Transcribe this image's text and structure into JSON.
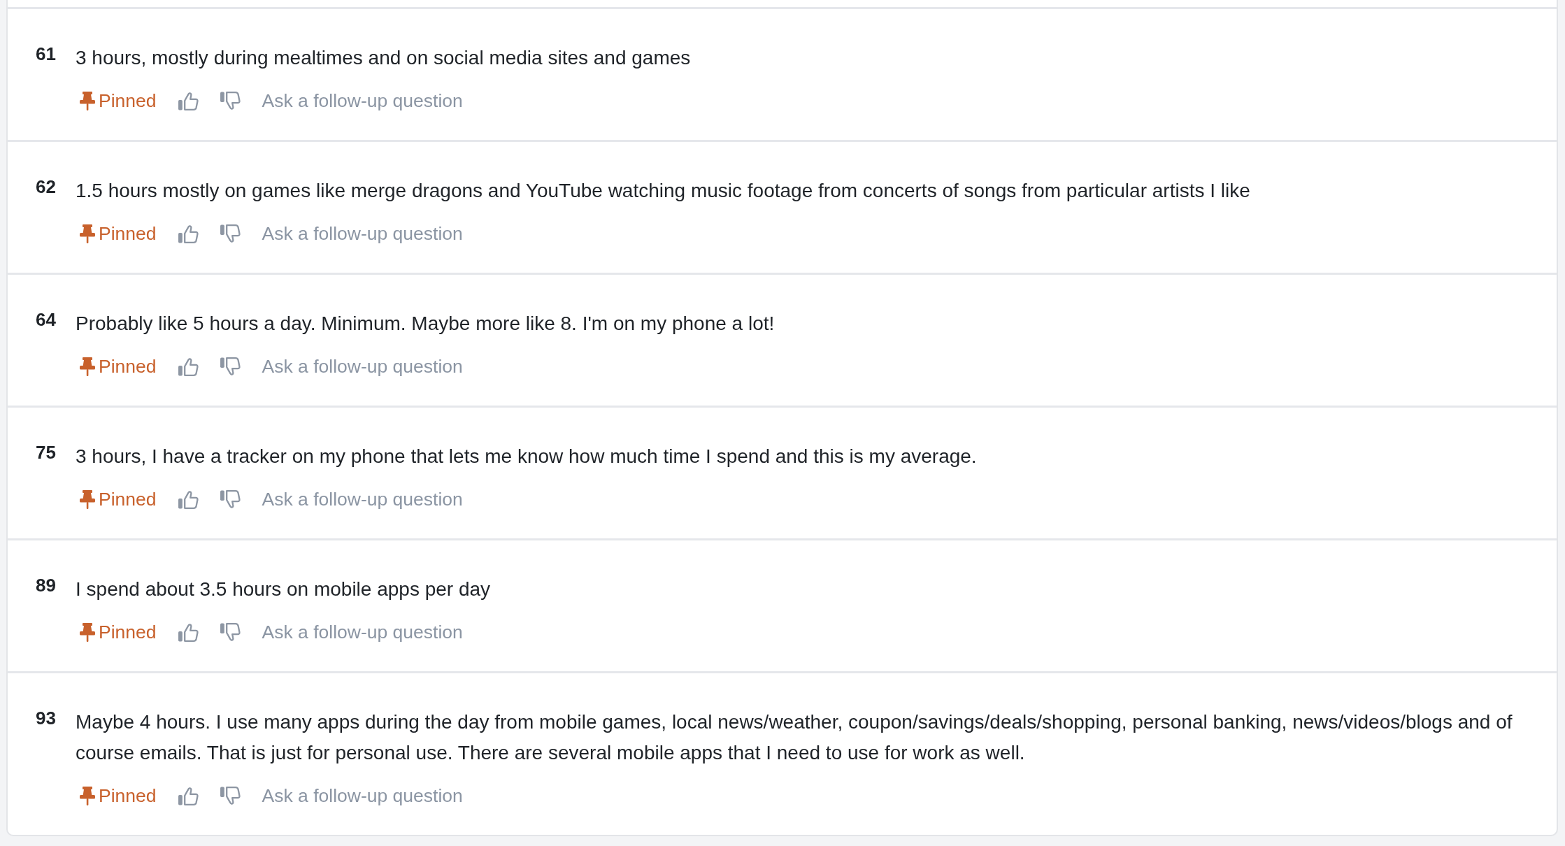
{
  "responses": [
    {
      "number": "61",
      "text": "3 hours, mostly during mealtimes and on social media sites and games",
      "pinned": true,
      "pin_label": "Pinned",
      "follow_up": "Ask a follow-up question"
    },
    {
      "number": "62",
      "text": "1.5 hours mostly on games like merge dragons and YouTube watching music footage from concerts of songs from particular artists I like",
      "pinned": true,
      "pin_label": "Pinned",
      "follow_up": "Ask a follow-up question"
    },
    {
      "number": "64",
      "text": "Probably like 5 hours a day. Minimum. Maybe more like 8. I'm on my phone a lot!",
      "pinned": true,
      "pin_label": "Pinned",
      "follow_up": "Ask a follow-up question"
    },
    {
      "number": "75",
      "text": "3 hours, I have a tracker on my phone that lets me know how much time I spend and this is my average.",
      "pinned": true,
      "pin_label": "Pinned",
      "follow_up": "Ask a follow-up question"
    },
    {
      "number": "89",
      "text": "I spend about 3.5 hours on mobile apps per day",
      "pinned": true,
      "pin_label": "Pinned",
      "follow_up": "Ask a follow-up question"
    },
    {
      "number": "93",
      "text": "Maybe 4 hours. I use many apps during the day from mobile games, local news/weather, coupon/savings/deals/shopping, personal banking, news/videos/blogs and of course emails. That is just for personal use. There are several mobile apps that I need to use for work as well.",
      "pinned": true,
      "pin_label": "Pinned",
      "follow_up": "Ask a follow-up question"
    }
  ]
}
